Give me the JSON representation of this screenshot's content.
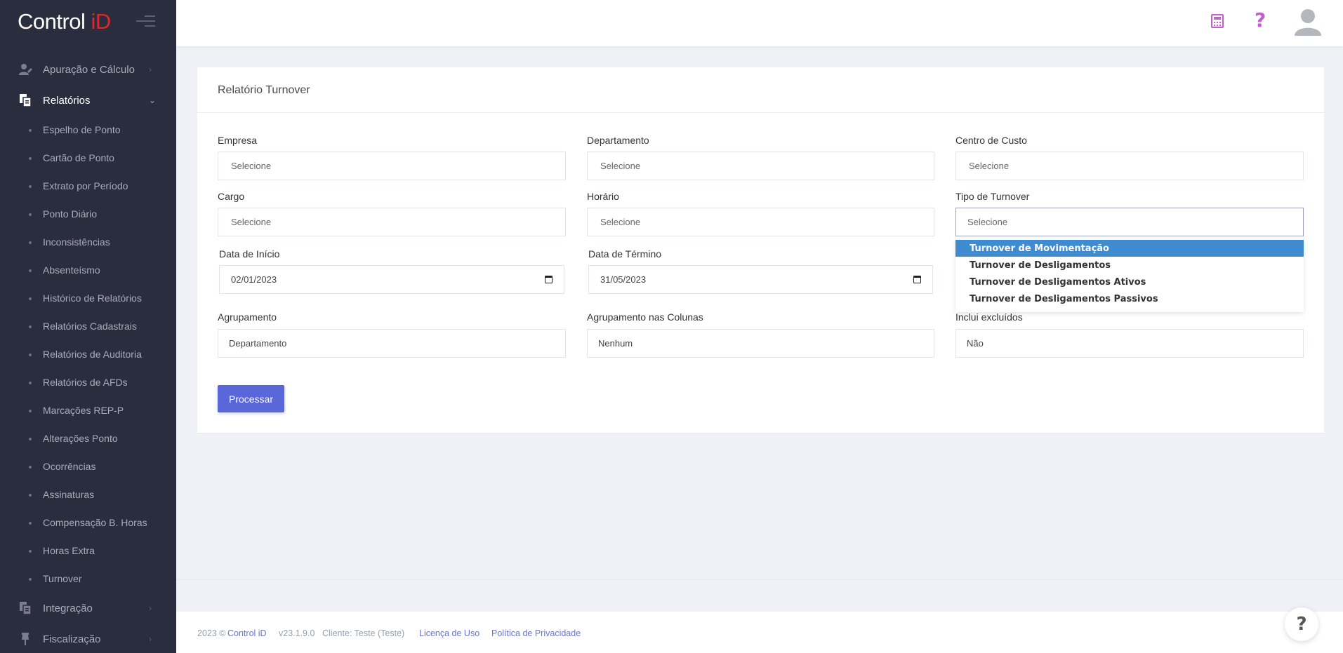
{
  "brand": {
    "name_main": "Control ",
    "name_accent": "iD"
  },
  "sidebar": {
    "main_items": [
      {
        "label": "Apuração e Cálculo",
        "icon": "user-edit-icon",
        "active": false,
        "expanded": false
      },
      {
        "label": "Relatórios",
        "icon": "documents-icon",
        "active": true,
        "expanded": true
      },
      {
        "label": "Integração",
        "icon": "documents-icon",
        "active": false,
        "expanded": false
      },
      {
        "label": "Fiscalização",
        "icon": "pin-icon",
        "active": false,
        "expanded": false
      }
    ],
    "sub_items": [
      "Espelho de Ponto",
      "Cartão de Ponto",
      "Extrato por Período",
      "Ponto Diário",
      "Inconsistências",
      "Absenteísmo",
      "Histórico de Relatórios",
      "Relatórios Cadastrais",
      "Relatórios de Auditoria",
      "Relatórios de AFDs",
      "Marcações REP-P",
      "Alterações Ponto",
      "Ocorrências",
      "Assinaturas",
      "Compensação B. Horas",
      "Horas Extra",
      "Turnover"
    ]
  },
  "topbar": {
    "icons": [
      "calculator-icon",
      "help-icon",
      "avatar-icon"
    ],
    "help_glyph": "?"
  },
  "form": {
    "title": "Relatório Turnover",
    "fields": {
      "empresa": {
        "label": "Empresa",
        "placeholder": "Selecione"
      },
      "departamento": {
        "label": "Departamento",
        "placeholder": "Selecione"
      },
      "centro_custo": {
        "label": "Centro de Custo",
        "placeholder": "Selecione"
      },
      "cargo": {
        "label": "Cargo",
        "placeholder": "Selecione"
      },
      "horario": {
        "label": "Horário",
        "placeholder": "Selecione"
      },
      "tipo_turnover": {
        "label": "Tipo de Turnover",
        "placeholder": "Selecione"
      },
      "data_inicio": {
        "label": "Data de Início",
        "value": "02/01/2023"
      },
      "data_termino": {
        "label": "Data de Término",
        "value": "31/05/2023"
      },
      "agrupamento": {
        "label": "Agrupamento",
        "value": "Departamento"
      },
      "agrupamento_colunas": {
        "label": "Agrupamento nas Colunas",
        "value": "Nenhum"
      },
      "inclui_excluidos": {
        "label": "Inclui excluídos",
        "value": "Não"
      }
    },
    "dropdown_options": [
      "Turnover de Movimentação",
      "Turnover de Desligamentos",
      "Turnover de Desligamentos Ativos",
      "Turnover de Desligamentos Passivos"
    ],
    "selected_option": "Turnover de Movimentação",
    "submit_label": "Processar"
  },
  "footer": {
    "year": "2023 ©",
    "brand_link": "Control iD",
    "version": "v23.1.9.0",
    "client": "Cliente: Teste (Teste)",
    "license_link": "Licença de Uso",
    "privacy_link": "Política de Privacidade",
    "help_glyph": "?"
  },
  "colors": {
    "sidebar_bg": "#2a2d3e",
    "accent_red": "#e2262c",
    "primary_button": "#5a67d8",
    "dropdown_selected": "#3e8bd0",
    "icon_purple": "#c061c9"
  }
}
